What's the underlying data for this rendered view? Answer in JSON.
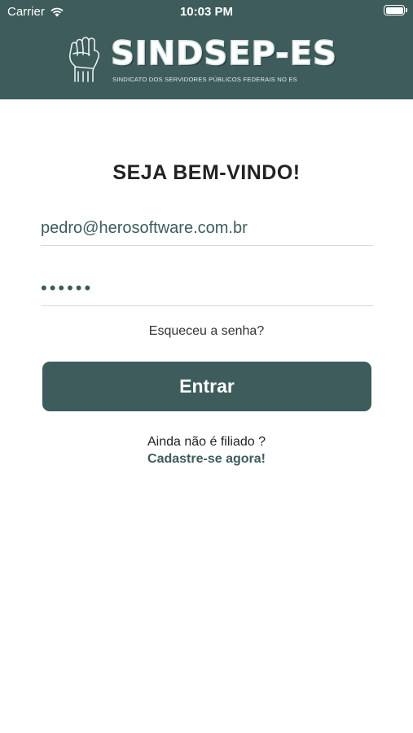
{
  "status_bar": {
    "carrier": "Carrier",
    "time": "10:03 PM",
    "icons": [
      "wifi-icon",
      "battery-icon"
    ]
  },
  "header": {
    "logo_title": "SINDSEP-ES",
    "logo_subtitle": "SINDICATO DOS SERVIDORES PÚBLICOS FEDERAIS NO ES",
    "logo_icon": "raised-fist-icon",
    "background_color": "#3d5c5b"
  },
  "login": {
    "welcome": "SEJA BEM-VINDO!",
    "email_value": "pedro@herosoftware.com.br",
    "password_value": "••••••",
    "forgot_password": "Esqueceu a senha?",
    "submit_label": "Entrar"
  },
  "signup": {
    "prompt": "Ainda não é filiado ?",
    "link_label": "Cadastre-se agora!"
  },
  "colors": {
    "primary": "#3d5c5b",
    "text_dark": "#222222",
    "divider": "#d9d9d9"
  }
}
